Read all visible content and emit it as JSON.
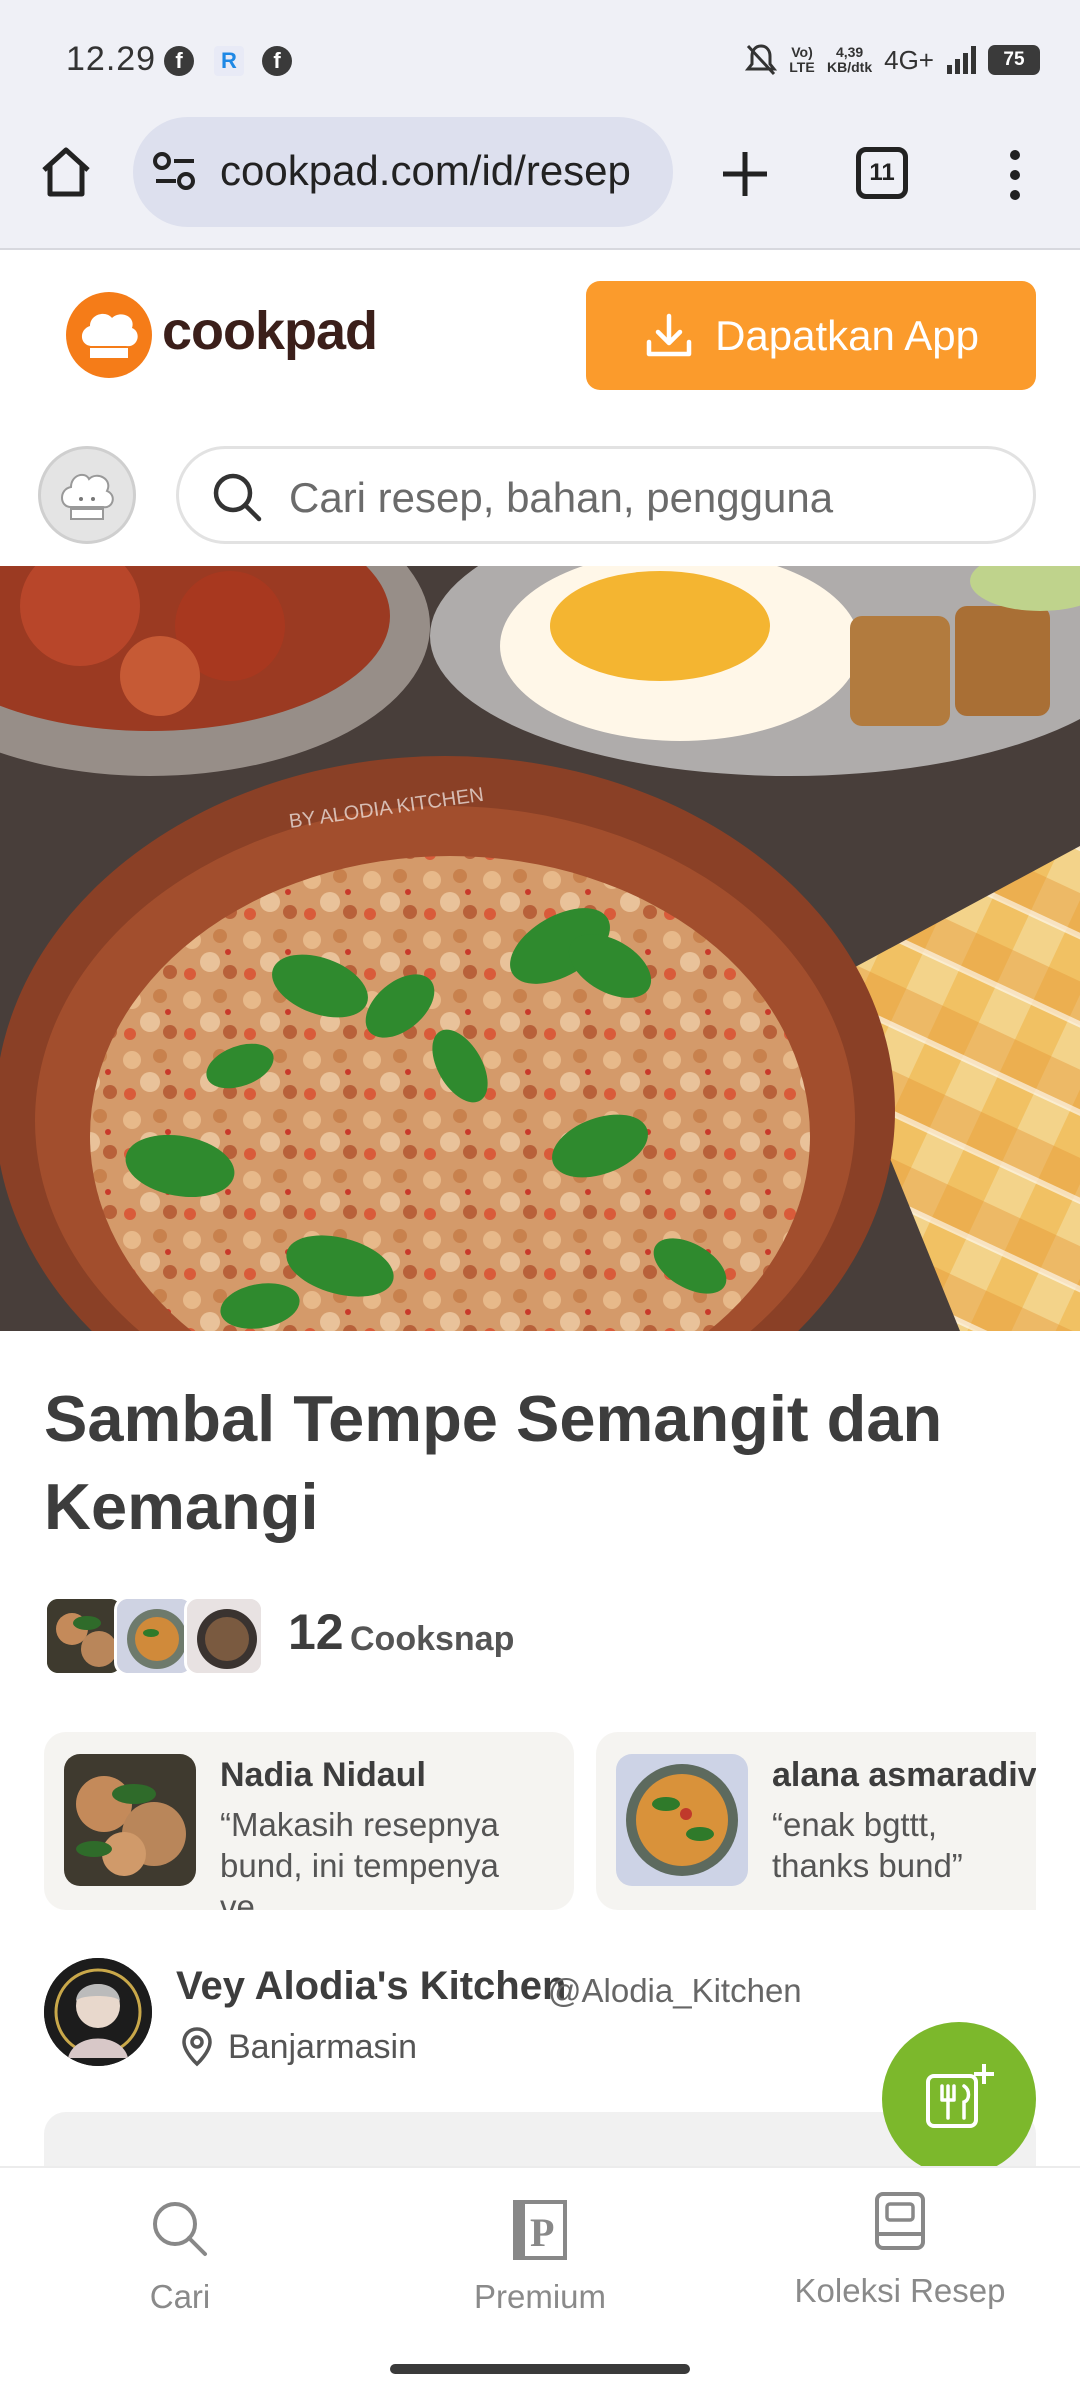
{
  "status_bar": {
    "time": "12.29",
    "app_icons": [
      "f",
      "R",
      "f"
    ],
    "network_speed_value": "4,39",
    "network_speed_unit": "KB/dtk",
    "network_type": "4G+",
    "volte_label": "Vo) LTE",
    "battery": "75"
  },
  "browser": {
    "url": "cookpad.com/id/resep",
    "tab_count": "11"
  },
  "header": {
    "logo_text": "cookpad",
    "app_button_label": "Dapatkan App"
  },
  "search": {
    "placeholder": "Cari resep, bahan, pengguna"
  },
  "hero": {
    "watermark": "BY ALODIA KITCHEN"
  },
  "recipe": {
    "title": "Sambal Tempe Semangit dan Kemangi",
    "cooksnap_count": "12",
    "cooksnap_label": "Cooksnap"
  },
  "cooksnaps": [
    {
      "name": "Nadia Nidaul",
      "comment": "“Makasih resepnya bund, ini tempenya ve..."
    },
    {
      "name": "alana asmaradiva",
      "comment": "“enak bgttt, thanks bund”"
    }
  ],
  "author": {
    "name": "Vey Alodia's Kitchen",
    "handle": "@Alodia_Kitchen",
    "location": "Banjarmasin"
  },
  "bottom_nav": {
    "items": [
      {
        "label": "Cari",
        "icon": "search-icon"
      },
      {
        "label": "Premium",
        "icon": "premium-icon"
      },
      {
        "label": "Koleksi Resep",
        "icon": "recipe-book-icon"
      }
    ]
  },
  "colors": {
    "brand_orange": "#fb9b2c",
    "fab_green": "#7cb82c"
  }
}
